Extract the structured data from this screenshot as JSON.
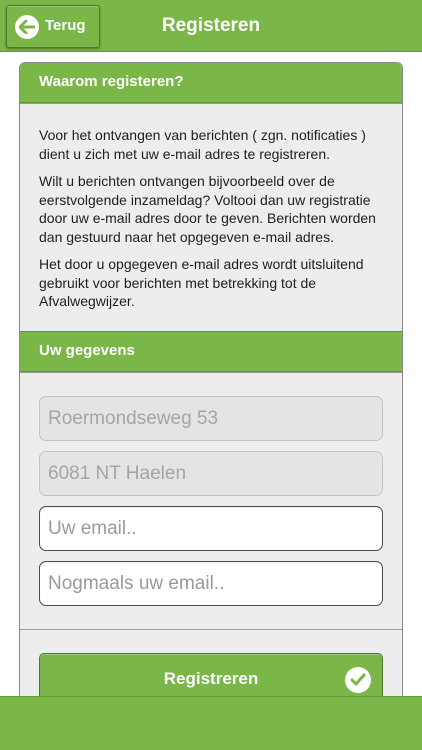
{
  "header": {
    "back_label": "Terug",
    "title": "Registeren"
  },
  "why": {
    "heading": "Waarom registeren?",
    "paragraphs": [
      "Voor het ontvangen van berichten ( zgn. notificaties ) dient u zich met uw e-mail adres te registreren.",
      "Wilt u berichten ontvangen bijvoorbeeld over de eerstvolgende inzameldag? Voltooi dan uw registratie door uw e-mail adres door te geven. Berichten worden dan gestuurd naar het opgegeven e-mail adres.",
      "Het door u opgegeven e-mail adres wordt uitsluitend gebruikt voor berichten met betrekking tot de Afvalwegwijzer."
    ]
  },
  "details": {
    "heading": "Uw gegevens",
    "address": "Roermondseweg  53",
    "postal_city": "6081 NT Haelen",
    "email_placeholder": "Uw email..",
    "email_repeat_placeholder": "Nogmaals uw email.."
  },
  "submit": {
    "label": "Registreren"
  },
  "icons": {
    "back": "arrow-left-icon",
    "submit": "checkmark-icon"
  },
  "colors": {
    "brand_green": "#7ab648",
    "card_bg": "#ededed"
  }
}
